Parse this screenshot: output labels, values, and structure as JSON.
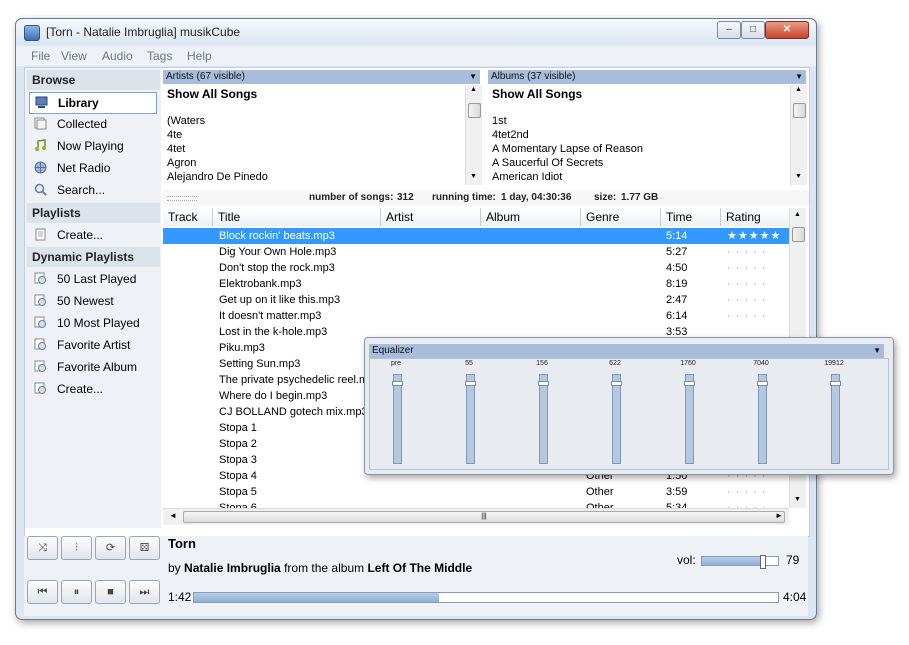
{
  "window": {
    "title": "[Torn - Natalie Imbruglia] musikCube",
    "controls": {
      "minimize": "–",
      "maximize": "□",
      "close": "✕"
    }
  },
  "menu": [
    "File",
    "View",
    "Audio",
    "Tags",
    "Help"
  ],
  "sidebar": {
    "browse_header": "Browse",
    "browse_items": [
      {
        "label": "Library",
        "icon": "library-icon"
      },
      {
        "label": "Collected",
        "icon": "collected-icon"
      },
      {
        "label": "Now Playing",
        "icon": "now-playing-icon"
      },
      {
        "label": "Net Radio",
        "icon": "net-radio-icon"
      },
      {
        "label": "Search...",
        "icon": "search-icon"
      }
    ],
    "playlists_header": "Playlists",
    "playlist_items": [
      {
        "label": "Create...",
        "icon": "create-icon"
      }
    ],
    "dynamic_header": "Dynamic Playlists",
    "dynamic_items": [
      {
        "label": "50 Last Played"
      },
      {
        "label": "50 Newest"
      },
      {
        "label": "10 Most Played"
      },
      {
        "label": "Favorite Artist"
      },
      {
        "label": "Favorite Album"
      },
      {
        "label": "Create..."
      }
    ]
  },
  "artists": {
    "header": "Artists (67 visible)",
    "items": [
      "Show All Songs",
      "",
      "(Waters",
      "4te",
      "4tet",
      "Agron",
      "Alejandro De Pinedo"
    ]
  },
  "albums": {
    "header": "Albums (37 visible)",
    "items": [
      "Show All Songs",
      "",
      "1st",
      "4tet2nd",
      "A Momentary Lapse of Reason",
      "A Saucerful Of Secrets",
      "American Idiot"
    ]
  },
  "status": {
    "songs_label": "number of songs:",
    "songs": "312",
    "runtime_label": "running time:",
    "runtime": "1 day, 04:30:36",
    "size_label": "size:",
    "size": "1.77 GB"
  },
  "table": {
    "columns": [
      "Track",
      "Title",
      "Artist",
      "Album",
      "Genre",
      "Time",
      "Rating"
    ],
    "rows": [
      {
        "title": "Block rockin' beats.mp3",
        "genre": "",
        "time": "5:14",
        "rating": "★★★★★"
      },
      {
        "title": "Dig Your Own Hole.mp3",
        "genre": "",
        "time": "5:27",
        "rating": "· · · · ·"
      },
      {
        "title": "Don't stop the rock.mp3",
        "genre": "",
        "time": "4:50",
        "rating": "· · · · ·"
      },
      {
        "title": "Elektrobank.mp3",
        "genre": "",
        "time": "8:19",
        "rating": "· · · · ·"
      },
      {
        "title": "Get up on it like this.mp3",
        "genre": "",
        "time": "2:47",
        "rating": "· · · · ·"
      },
      {
        "title": "It doesn't matter.mp3",
        "genre": "",
        "time": "6:14",
        "rating": "· · · · ·"
      },
      {
        "title": "Lost in the k-hole.mp3",
        "genre": "",
        "time": "3:53",
        "rating": ""
      },
      {
        "title": "Piku.mp3",
        "genre": "",
        "time": "",
        "rating": ""
      },
      {
        "title": "Setting Sun.mp3",
        "genre": "",
        "time": "",
        "rating": ""
      },
      {
        "title": "The private psychedelic reel.mp3",
        "genre": "",
        "time": "",
        "rating": ""
      },
      {
        "title": "Where do I begin.mp3",
        "genre": "",
        "time": "",
        "rating": ""
      },
      {
        "title": "CJ BOLLAND  gotech mix.mp3",
        "genre": "",
        "time": "",
        "rating": ""
      },
      {
        "title": "Stopa  1",
        "genre": "",
        "time": "",
        "rating": ""
      },
      {
        "title": "Stopa  2",
        "genre": "",
        "time": "",
        "rating": ""
      },
      {
        "title": "Stopa  3",
        "genre": "",
        "time": "",
        "rating": ""
      },
      {
        "title": "Stopa  4",
        "genre": "Other",
        "time": "1:50",
        "rating": "· · · · ·"
      },
      {
        "title": "Stopa  5",
        "genre": "Other",
        "time": "3:59",
        "rating": "· · · · ·"
      },
      {
        "title": "Stopa  6",
        "genre": "Other",
        "time": "5:34",
        "rating": "· · · · ·"
      }
    ]
  },
  "equalizer": {
    "title": "Equalizer",
    "bands": [
      {
        "label": "pre",
        "level": 0.93
      },
      {
        "label": "55",
        "level": 0.93
      },
      {
        "label": "156",
        "level": 0.93
      },
      {
        "label": "622",
        "level": 0.93
      },
      {
        "label": "1760",
        "level": 0.93
      },
      {
        "label": "7040",
        "level": 0.93
      },
      {
        "label": "19912",
        "level": 0.93
      }
    ]
  },
  "player": {
    "song_title": "Torn",
    "by": "by",
    "artist": "Natalie Imbruglia",
    "from_album": "from the album",
    "album": "Left Of The Middle",
    "vol_label": "vol:",
    "volume": "79",
    "volume_level": 0.79,
    "elapsed": "1:42",
    "total": "4:04",
    "progress_level": 0.42,
    "buttons": {
      "shuffle": "⤨",
      "equalizer": "⫶",
      "repeat": "⟳",
      "random": "⚄",
      "prev": "⏮",
      "pause": "⏸",
      "stop": "■",
      "next": "⏭"
    }
  }
}
